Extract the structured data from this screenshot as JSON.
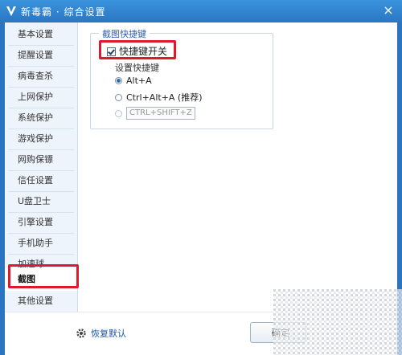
{
  "window": {
    "title": "新毒霸 · 综合设置",
    "close_glyph": "×"
  },
  "sidebar": {
    "items": [
      {
        "label": "基本设置"
      },
      {
        "label": "提醒设置"
      },
      {
        "label": "病毒查杀"
      },
      {
        "label": "上网保护"
      },
      {
        "label": "系统保护"
      },
      {
        "label": "游戏保护"
      },
      {
        "label": "网购保镖"
      },
      {
        "label": "信任设置"
      },
      {
        "label": "U盘卫士"
      },
      {
        "label": "引擎设置"
      },
      {
        "label": "手机助手"
      },
      {
        "label": "加速球"
      },
      {
        "label": "截图"
      },
      {
        "label": "其他设置"
      }
    ],
    "active": "截图"
  },
  "screenshot_group": {
    "title": "截图快捷键",
    "toggle_label": "快捷键开关",
    "toggle_checked": true,
    "hotkey_label": "设置快捷键",
    "options": [
      {
        "label": "Alt+A",
        "selected": true
      },
      {
        "label": "Ctrl+Alt+A (推荐)",
        "selected": false
      },
      {
        "label": "CTRL+SHIFT+Z",
        "selected": false
      }
    ]
  },
  "footer": {
    "restore_label": "恢复默认",
    "ok_label": "确定"
  },
  "colors": {
    "highlight": "#e0182d",
    "title_bar": "#2a74c0",
    "accent": "#2a5ea8"
  },
  "icons": {
    "logo": "shield-v-icon",
    "restore": "gear-icon"
  }
}
